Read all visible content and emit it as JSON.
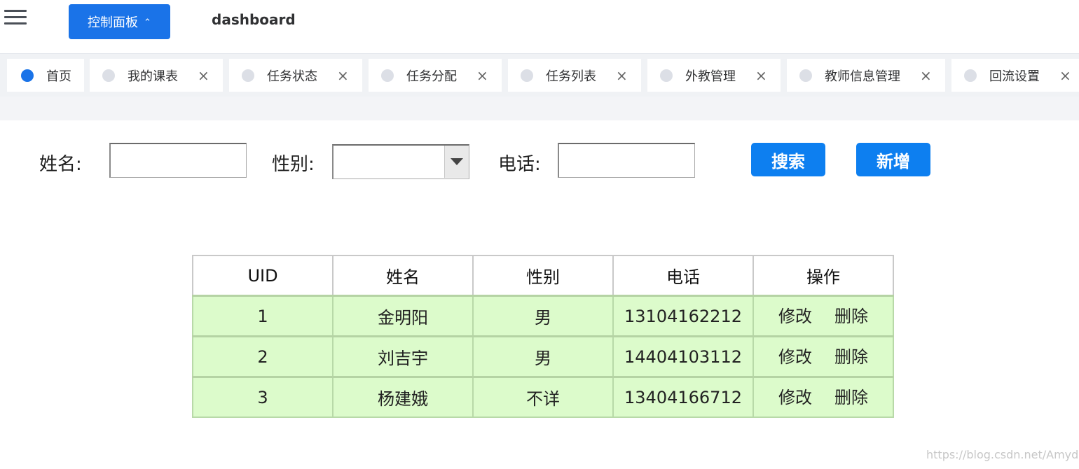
{
  "header": {
    "panel_button_label": "控制面板",
    "breadcrumb": "dashboard"
  },
  "tags": [
    {
      "label": "首页",
      "active": true,
      "closable": false
    },
    {
      "label": "我的课表",
      "active": false,
      "closable": true
    },
    {
      "label": "任务状态",
      "active": false,
      "closable": true
    },
    {
      "label": "任务分配",
      "active": false,
      "closable": true
    },
    {
      "label": "任务列表",
      "active": false,
      "closable": true
    },
    {
      "label": "外教管理",
      "active": false,
      "closable": true
    },
    {
      "label": "教师信息管理",
      "active": false,
      "closable": true
    },
    {
      "label": "回流设置",
      "active": false,
      "closable": true
    }
  ],
  "tag_close_glyph": "×",
  "search": {
    "name_label": "姓名:",
    "name_value": "",
    "gender_label": "性别:",
    "gender_value": "",
    "phone_label": "电话:",
    "phone_value": "",
    "search_button": "搜索",
    "add_button": "新增"
  },
  "table": {
    "columns": [
      "UID",
      "姓名",
      "性别",
      "电话",
      "操作"
    ],
    "rows": [
      {
        "uid": "1",
        "name": "金明阳",
        "gender": "男",
        "phone": "13104162212"
      },
      {
        "uid": "2",
        "name": "刘吉宇",
        "gender": "男",
        "phone": "14404103112"
      },
      {
        "uid": "3",
        "name": "杨建娥",
        "gender": "不详",
        "phone": "13404166712"
      }
    ],
    "edit_label": "修改",
    "delete_label": "删除"
  },
  "watermark": "https://blog.csdn.net/Amydom",
  "colors": {
    "primary": "#1a73e8",
    "button_blue": "#0d7ff0",
    "row_green": "#dcfbcb"
  }
}
